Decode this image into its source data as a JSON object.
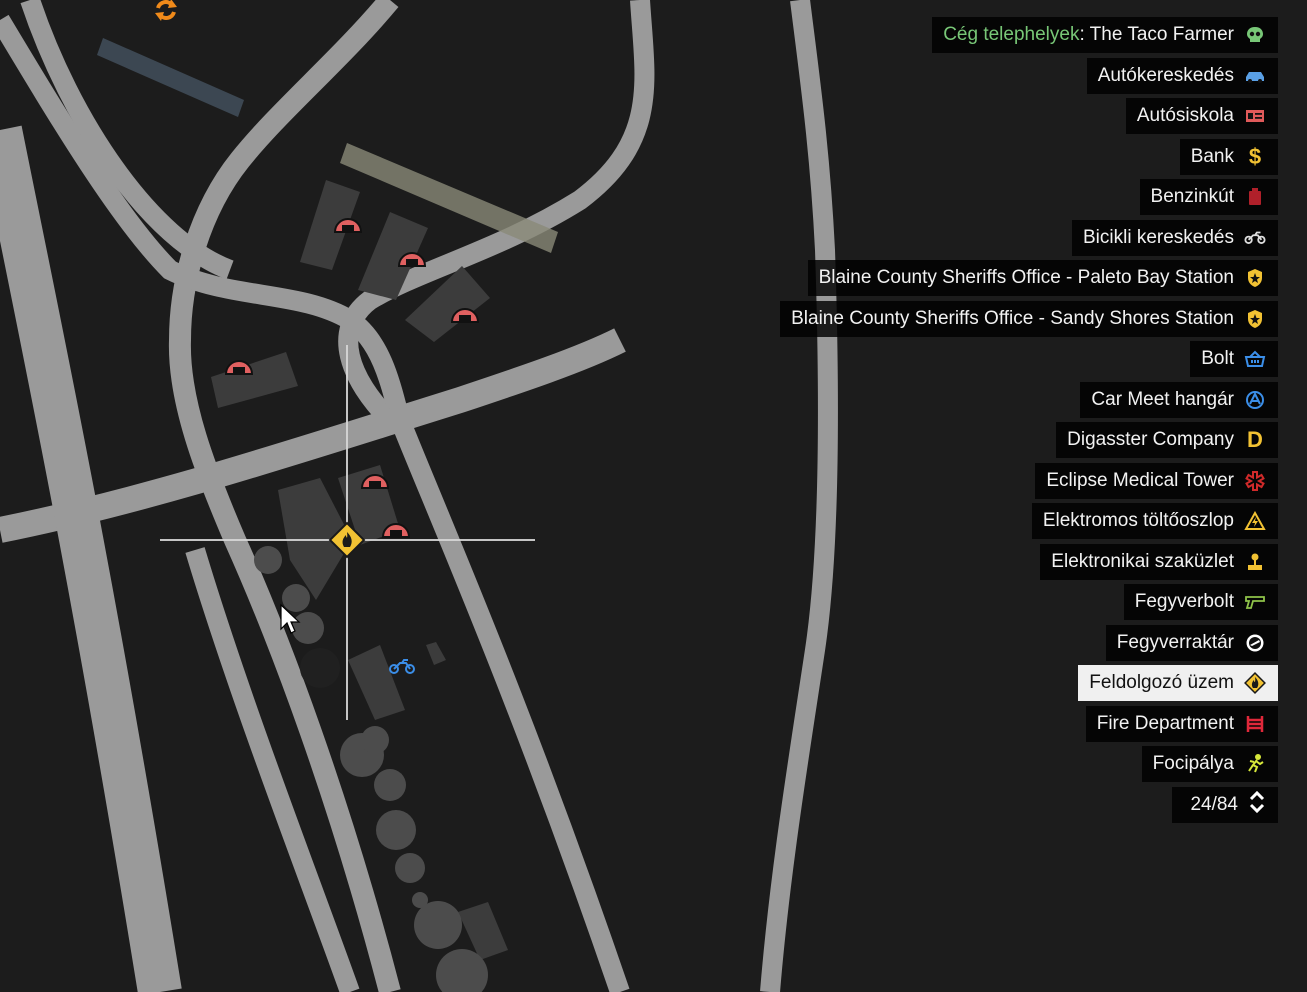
{
  "legend": {
    "items": [
      {
        "prefix": "Cég telephelyek",
        "sep": ":",
        "label": " The Taco Farmer",
        "icon": "skull-icon",
        "color": "#78c777"
      },
      {
        "label": "Autókereskedés",
        "icon": "car-icon",
        "color": "#5aa0e6"
      },
      {
        "label": "Autósiskola",
        "icon": "license-card-icon",
        "color": "#e05a5a"
      },
      {
        "label": "Bank",
        "icon": "dollar-icon",
        "color": "#f2c233"
      },
      {
        "label": "Benzinkút",
        "icon": "fuel-can-icon",
        "color": "#b0202a"
      },
      {
        "label": "Bicikli kereskedés",
        "icon": "motorbike-icon",
        "color": "#dddddd"
      },
      {
        "label": "Blaine County Sheriffs Office - Paleto Bay Station",
        "icon": "sheriff-badge-icon",
        "color": "#f2c233"
      },
      {
        "label": "Blaine County Sheriffs Office - Sandy Shores Station",
        "icon": "sheriff-badge-icon",
        "color": "#f2c233"
      },
      {
        "label": "Bolt",
        "icon": "shopping-basket-icon",
        "color": "#3b8ee8"
      },
      {
        "label": "Car Meet hangár",
        "icon": "car-meet-icon",
        "color": "#3b8ee8"
      },
      {
        "label": "Digasster Company",
        "icon": "letter-d-icon",
        "color": "#f2c233"
      },
      {
        "label": "Eclipse Medical Tower",
        "icon": "medical-star-icon",
        "color": "#d02a2a"
      },
      {
        "label": "Elektromos töltőoszlop",
        "icon": "electric-warning-icon",
        "color": "#f2c233"
      },
      {
        "label": "Elektronikai szaküzlet",
        "icon": "joystick-icon",
        "color": "#f2c233"
      },
      {
        "label": "Fegyverbolt",
        "icon": "pistol-icon",
        "color": "#8fc34a"
      },
      {
        "label": "Fegyverraktár",
        "icon": "weapon-crate-icon",
        "color": "#ffffff"
      },
      {
        "label": "Feldolgozó üzem",
        "icon": "flame-diamond-icon",
        "color": "#f2c233",
        "selected": true
      },
      {
        "label": "Fire Department",
        "icon": "fire-truck-icon",
        "color": "#e0283a"
      },
      {
        "label": "Focipálya",
        "icon": "runner-icon",
        "color": "#d7e83a"
      }
    ],
    "pager": "24/84"
  },
  "map": {
    "markers": [
      {
        "name": "garage-icon"
      },
      {
        "name": "refresh-icon"
      },
      {
        "name": "flame-diamond-icon"
      },
      {
        "name": "motorbike-icon"
      },
      {
        "name": "mouse-cursor-icon"
      }
    ]
  }
}
